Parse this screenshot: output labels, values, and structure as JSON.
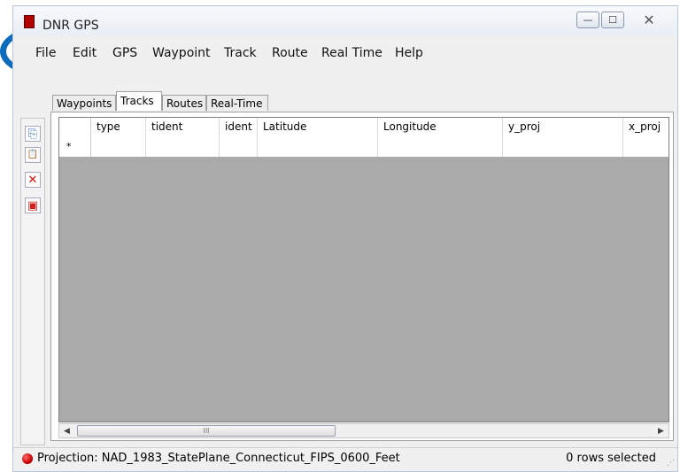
{
  "window": {
    "title": "DNR GPS",
    "controls": {
      "minimize": "—",
      "maximize": "☐",
      "close": "✕"
    }
  },
  "menu": [
    "File",
    "Edit",
    "GPS",
    "Waypoint",
    "Track",
    "Route",
    "Real Time",
    "Help"
  ],
  "tabs": [
    {
      "label": "Waypoints",
      "active": false
    },
    {
      "label": "Tracks",
      "active": true
    },
    {
      "label": "Routes",
      "active": false
    },
    {
      "label": "Real-Time",
      "active": false
    }
  ],
  "toolbar": [
    {
      "icon": "copy-icon",
      "glyph": "⎘"
    },
    {
      "icon": "paste-icon",
      "glyph": "📋"
    },
    {
      "icon": "delete-icon",
      "glyph": "✕"
    },
    {
      "icon": "delete-all-icon",
      "glyph": "▣"
    }
  ],
  "grid": {
    "columns": [
      "type",
      "tident",
      "ident",
      "Latitude",
      "Longitude",
      "y_proj",
      "x_proj"
    ],
    "new_row_marker": "*"
  },
  "scrollbar": {
    "left": "◀",
    "right": "▶",
    "thumb_grip": "III"
  },
  "status": {
    "projection": "Projection: NAD_1983_StatePlane_Connecticut_FIPS_0600_Feet",
    "rows_selected": "0 rows selected",
    "grip": "⋰"
  },
  "colors": {
    "grid_background": "#aaaaaa",
    "highlight_circle": "#0d6bbd",
    "status_dot": "#cc0000"
  }
}
